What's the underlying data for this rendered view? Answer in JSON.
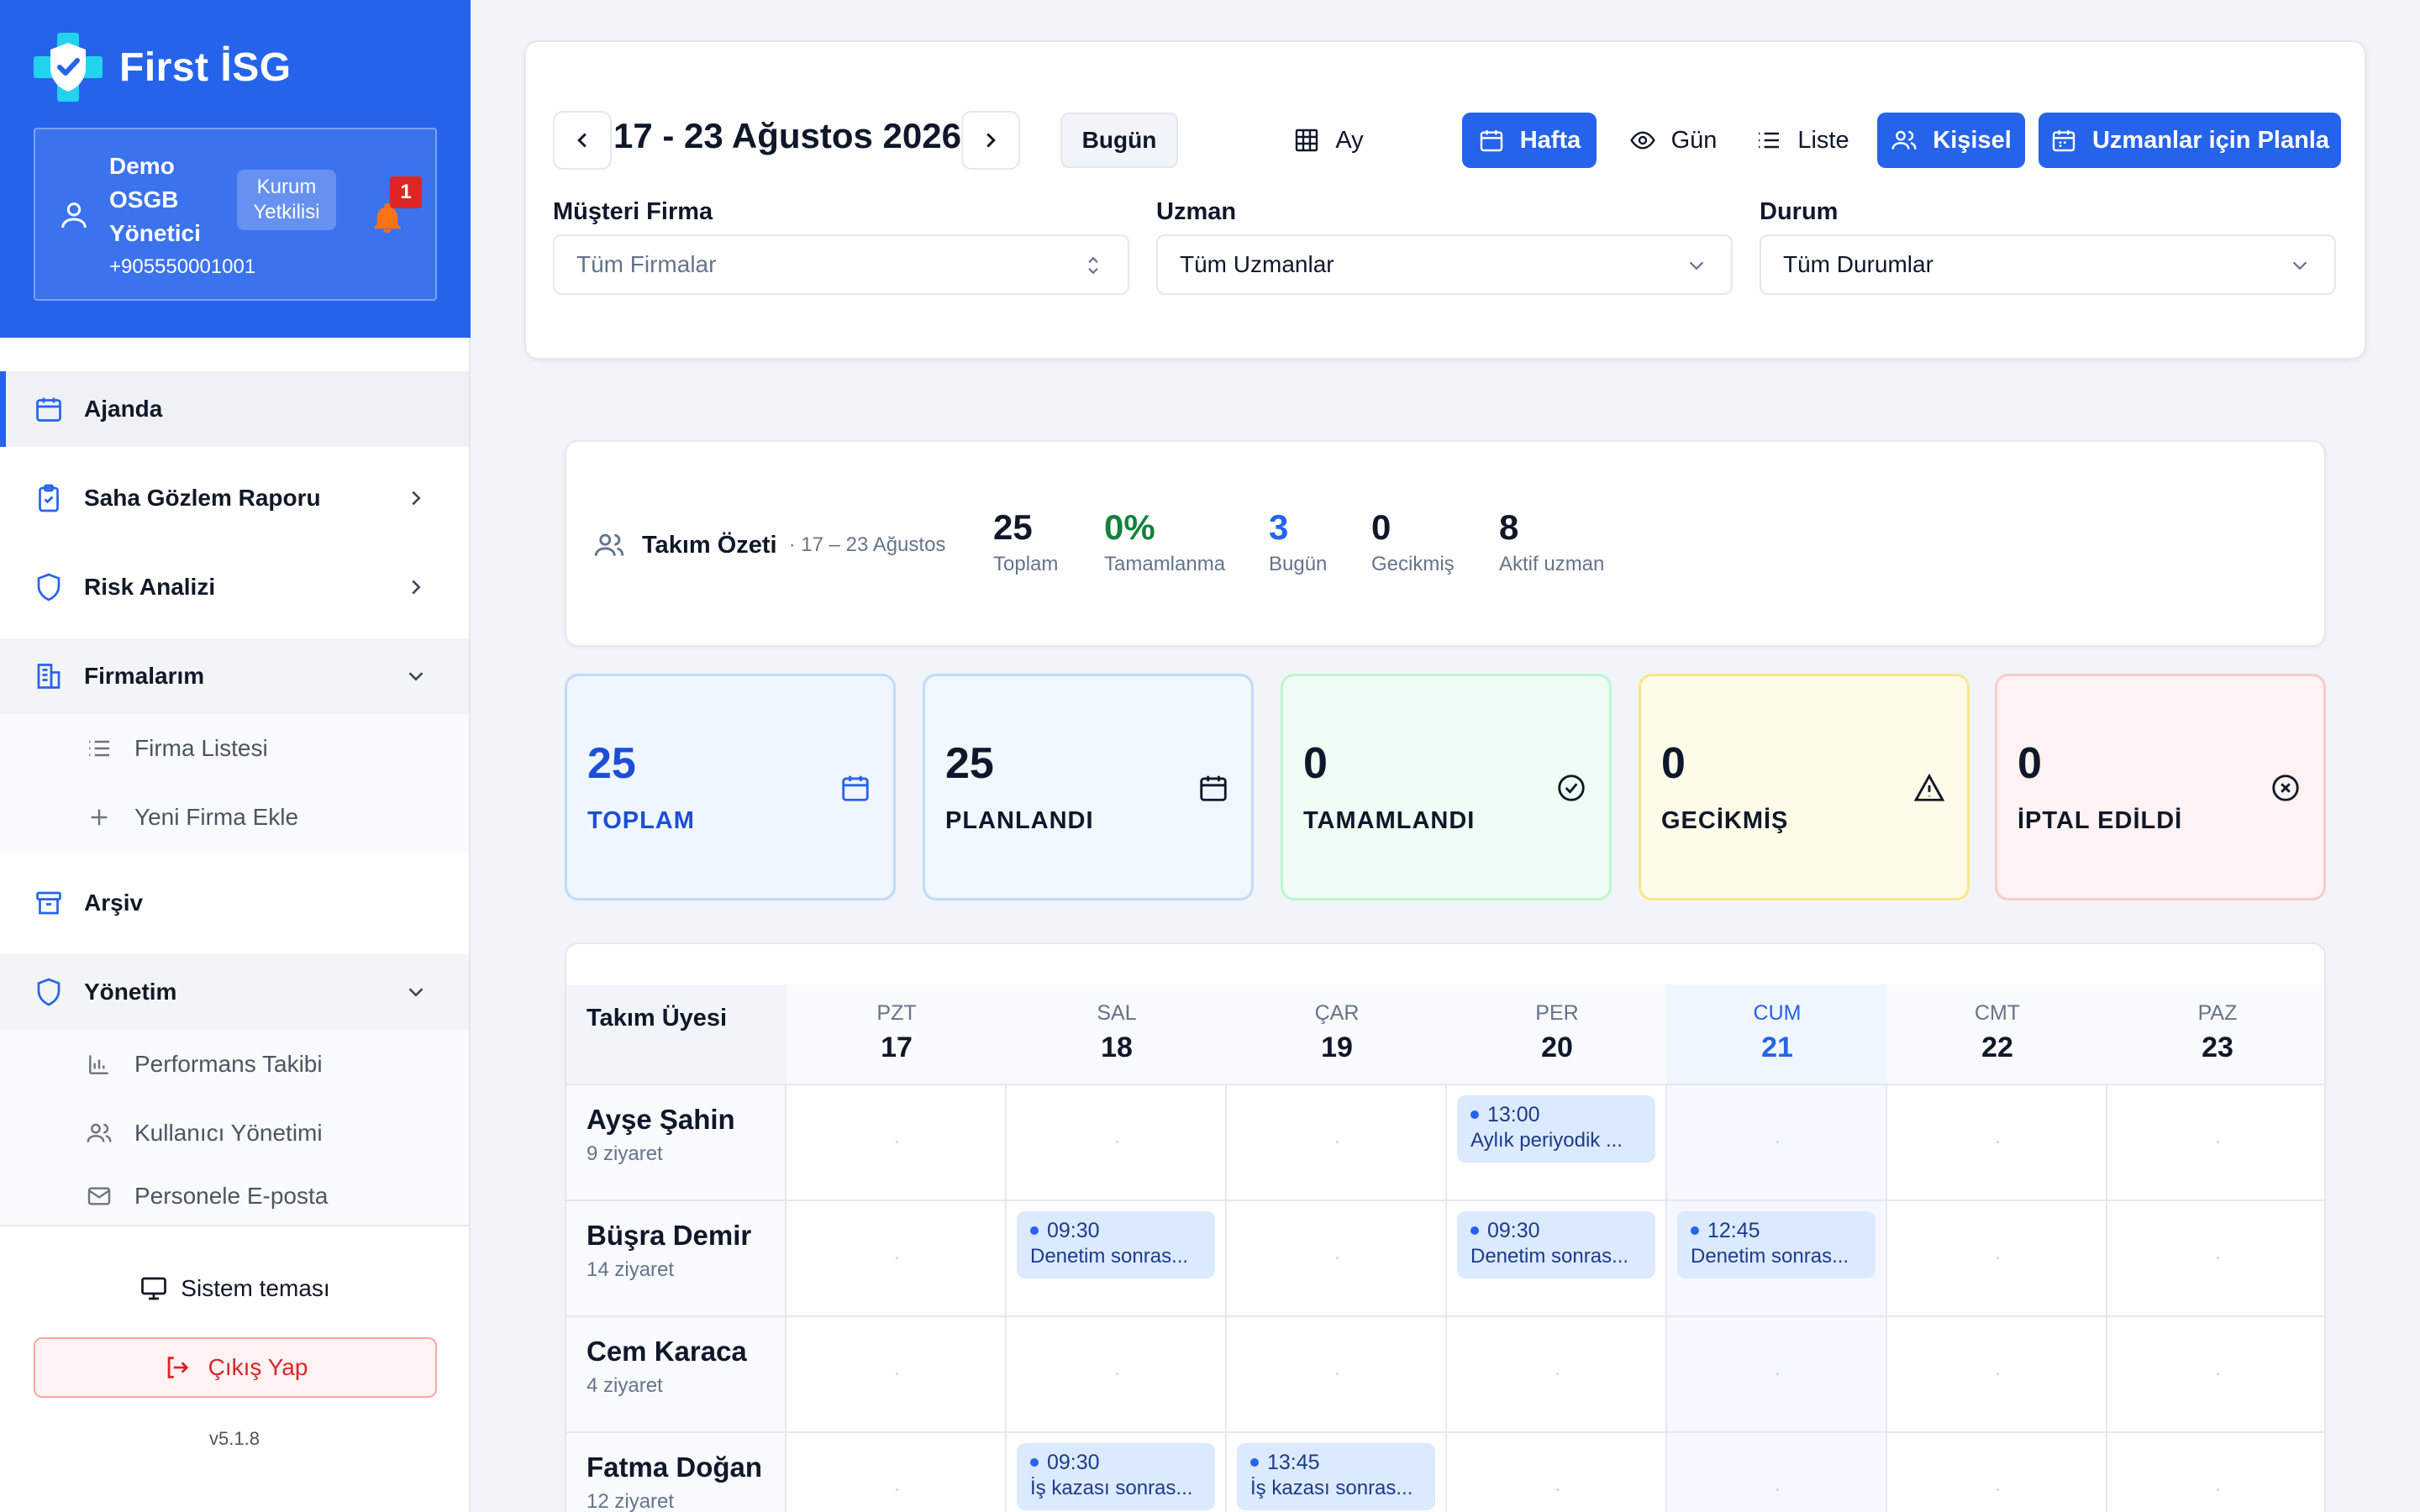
{
  "brand": {
    "name": "First İSG"
  },
  "user": {
    "name": "Demo OSGB Yönetici",
    "role": "Kurum Yetkilisi",
    "phone": "+905550001001",
    "notifications": "1"
  },
  "nav": {
    "items": [
      {
        "label": "Ajanda"
      },
      {
        "label": "Saha Gözlem Raporu"
      },
      {
        "label": "Risk Analizi"
      },
      {
        "label": "Firmalarım"
      },
      {
        "label": "Arşiv"
      },
      {
        "label": "Yönetim"
      }
    ],
    "firmalarim_sub": [
      {
        "label": "Firma Listesi"
      },
      {
        "label": "Yeni Firma Ekle"
      }
    ],
    "yonetim_sub": [
      {
        "label": "Performans Takibi"
      },
      {
        "label": "Kullanıcı Yönetimi"
      },
      {
        "label": "Personele E-posta"
      }
    ]
  },
  "footer": {
    "theme": "Sistem teması",
    "logout": "Çıkış Yap",
    "version": "v5.1.8"
  },
  "header": {
    "date_range": "17 - 23 Ağustos 2026",
    "today": "Bugün",
    "views": {
      "month": "Ay",
      "week": "Hafta",
      "day": "Gün",
      "list": "Liste"
    },
    "personal": "Kişisel",
    "plan": "Uzmanlar için Planla"
  },
  "filters": {
    "firm": {
      "label": "Müşteri Firma",
      "value": "Tüm Firmalar"
    },
    "expert": {
      "label": "Uzman",
      "value": "Tüm Uzmanlar"
    },
    "status": {
      "label": "Durum",
      "value": "Tüm Durumlar"
    }
  },
  "summary": {
    "title": "Takım Özeti",
    "range": "· 17 – 23 Ağustos",
    "stats": [
      {
        "value": "25",
        "label": "Toplam",
        "color": "#0f172a"
      },
      {
        "value": "0%",
        "label": "Tamamlanma",
        "color": "#15803d"
      },
      {
        "value": "3",
        "label": "Bugün",
        "color": "#2563eb"
      },
      {
        "value": "0",
        "label": "Gecikmiş",
        "color": "#0f172a"
      },
      {
        "value": "8",
        "label": "Aktif uzman",
        "color": "#0f172a"
      }
    ]
  },
  "status_cards": [
    {
      "value": "25",
      "label": "TOPLAM",
      "bg": "#eff6ff",
      "border": "#bfdbfe",
      "color": "#1d4ed8",
      "icon": "calendar-icon"
    },
    {
      "value": "25",
      "label": "PLANLANDI",
      "bg": "#f0f7ff",
      "border": "#bfdbfe",
      "color": "#0f172a",
      "icon": "calendar-icon"
    },
    {
      "value": "0",
      "label": "TAMAMLANDI",
      "bg": "#f0fdf4",
      "border": "#bbf7d0",
      "color": "#0f172a",
      "icon": "check-circle-icon"
    },
    {
      "value": "0",
      "label": "GECİKMİŞ",
      "bg": "#fefce8",
      "border": "#fde68a",
      "color": "#0f172a",
      "icon": "warning-icon"
    },
    {
      "value": "0",
      "label": "İPTAL EDİLDİ",
      "bg": "#fef2f2",
      "border": "#fecaca",
      "color": "#0f172a",
      "icon": "x-circle-icon"
    }
  ],
  "calendar": {
    "first_col": "Takım Üyesi",
    "days": [
      {
        "abbr": "PZT",
        "num": "17"
      },
      {
        "abbr": "SAL",
        "num": "18"
      },
      {
        "abbr": "ÇAR",
        "num": "19"
      },
      {
        "abbr": "PER",
        "num": "20"
      },
      {
        "abbr": "CUM",
        "num": "21",
        "today": true
      },
      {
        "abbr": "CMT",
        "num": "22"
      },
      {
        "abbr": "PAZ",
        "num": "23"
      }
    ],
    "rows": [
      {
        "name": "Ayşe Şahin",
        "visits": "9 ziyaret",
        "events": [
          {
            "day": 3,
            "time": "13:00",
            "desc": "Aylık periyodik ..."
          }
        ]
      },
      {
        "name": "Büşra Demir",
        "visits": "14 ziyaret",
        "events": [
          {
            "day": 1,
            "time": "09:30",
            "desc": "Denetim sonras..."
          },
          {
            "day": 3,
            "time": "09:30",
            "desc": "Denetim sonras..."
          },
          {
            "day": 4,
            "time": "12:45",
            "desc": "Denetim sonras..."
          }
        ]
      },
      {
        "name": "Cem Karaca",
        "visits": "4 ziyaret",
        "events": []
      },
      {
        "name": "Fatma Doğan",
        "visits": "12 ziyaret",
        "events": [
          {
            "day": 1,
            "time": "09:30",
            "desc": "İş kazası sonras..."
          },
          {
            "day": 2,
            "time": "13:45",
            "desc": "İş kazası sonras..."
          }
        ]
      }
    ]
  }
}
